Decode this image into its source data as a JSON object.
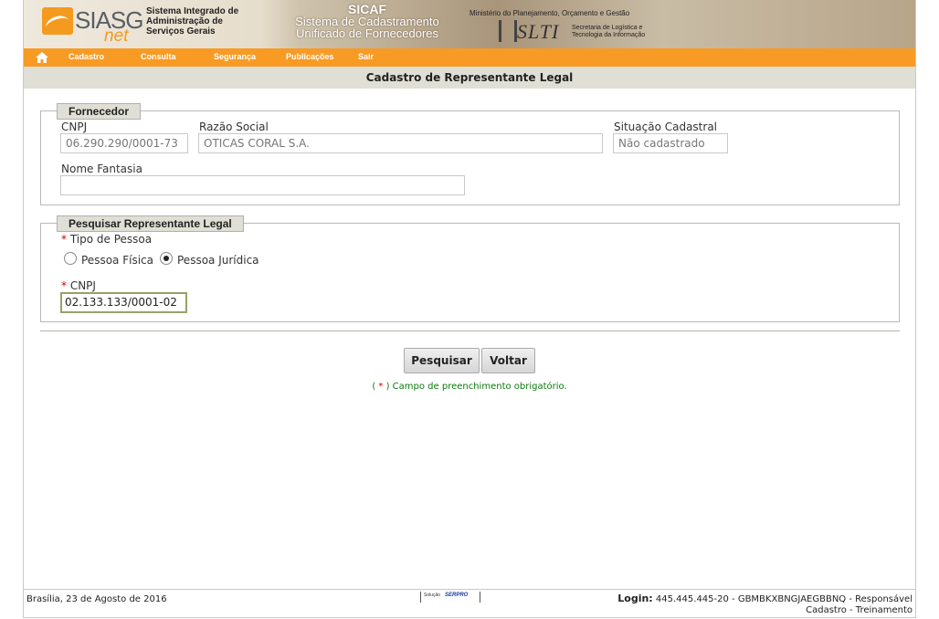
{
  "banner": {
    "logo_text": "SIASG",
    "logo_net": "net",
    "system_name": "Sistema Integrado de\nAdministração de\nServiços Gerais",
    "sicaf_line1": "SICAF",
    "sicaf_line2": "Sistema de Cadastramento",
    "sicaf_line3": "Unificado de Fornecedores",
    "ministry": "Ministério do Planejamento, Orçamento e Gestão",
    "slti_logo": "SLTI",
    "slti_sub": "Secretaria de Logística e\nTecnologia da Informação"
  },
  "menu": {
    "home_icon": "home-icon",
    "items": [
      "Cadastro",
      "Consulta",
      "Segurança",
      "Publicações",
      "Sair"
    ]
  },
  "page_title": "Cadastro de Representante Legal",
  "fornecedor": {
    "legend": "Fornecedor",
    "cnpj_label": "CNPJ",
    "cnpj_value": "06.290.290/0001-73",
    "razao_label": "Razão Social",
    "razao_value": "OTICAS CORAL S.A.",
    "situacao_label": "Situação Cadastral",
    "situacao_value": "Não cadastrado",
    "fantasia_label": "Nome Fantasia",
    "fantasia_value": ""
  },
  "pesquisar": {
    "legend": "Pesquisar Representante Legal",
    "required_mark": "*",
    "tipo_label": "Tipo de Pessoa",
    "opcao_fisica": "Pessoa Física",
    "opcao_juridica": "Pessoa Jurídica",
    "selected": "Pessoa Jurídica",
    "cnpj_label": "CNPJ",
    "cnpj_value": "02.133.133/0001-02"
  },
  "buttons": {
    "pesquisar": "Pesquisar",
    "voltar": "Voltar"
  },
  "required_note": {
    "open": "( ",
    "star": "*",
    "text": " ) Campo de preenchimento obrigatório."
  },
  "footer": {
    "date": "Brasília, 23 de Agosto de 2016",
    "logo_small": "Solução",
    "logo_brand": "SERPRO",
    "login_label": "Login:",
    "login_value": "445.445.445-20 - GBMBKXBNGJAEGBBNQ - Responsável",
    "login_line2": "Cadastro - Treinamento"
  },
  "colors": {
    "menu_bar": "#f79b25",
    "title_bar": "#dfdfd5",
    "required": "#cc0000",
    "note": "#0a7a0a"
  }
}
